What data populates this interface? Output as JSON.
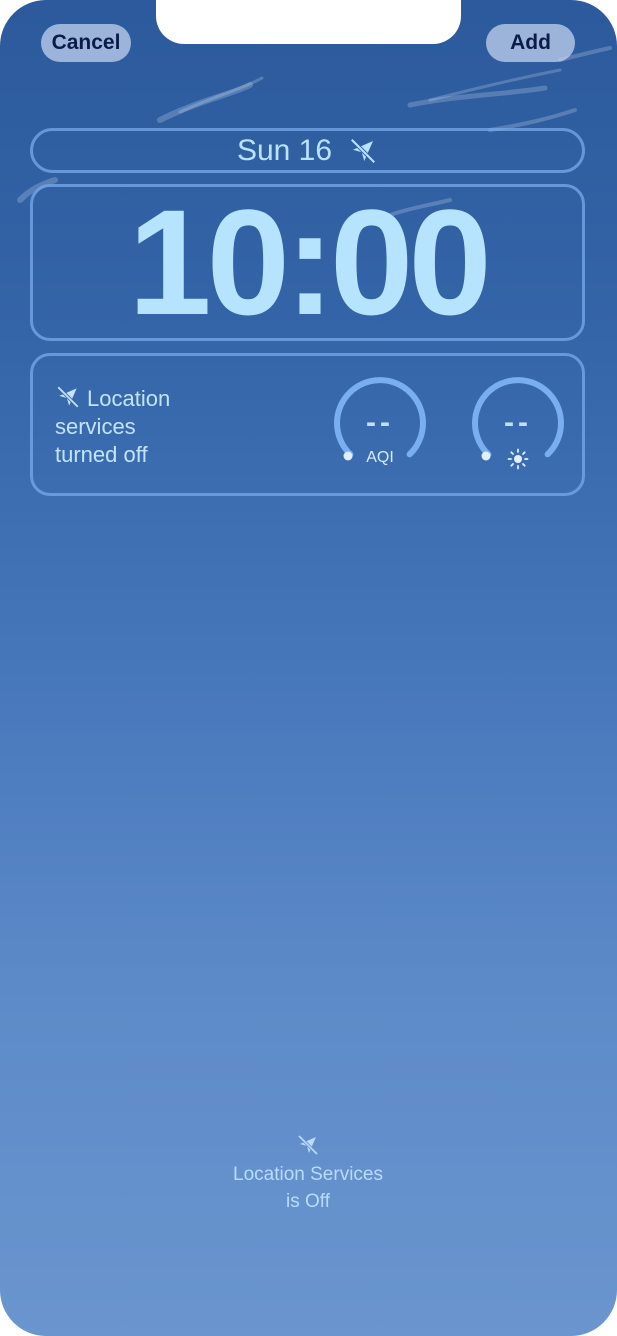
{
  "header": {
    "cancel_label": "Cancel",
    "add_label": "Add"
  },
  "lock_screen": {
    "date": "Sun 16",
    "date_icon": "location-off-icon",
    "time": "10:00"
  },
  "widgets": {
    "location": {
      "icon": "location-off-icon",
      "line1": "Location",
      "line2": "services",
      "line3": "turned off"
    },
    "aqi_gauge": {
      "value": "--",
      "label": "AQI"
    },
    "uv_gauge": {
      "value": "--",
      "icon": "sun-icon"
    }
  },
  "bottom_status": {
    "icon": "location-off-icon",
    "line1": "Location Services",
    "line2": "is Off"
  },
  "colors": {
    "sky_top": "#2c5a9c",
    "sky_bottom": "#6a95ce",
    "clock_text": "#b6e4ff",
    "button_bg": "#c8d7f0",
    "button_text": "#0b1c4a"
  }
}
